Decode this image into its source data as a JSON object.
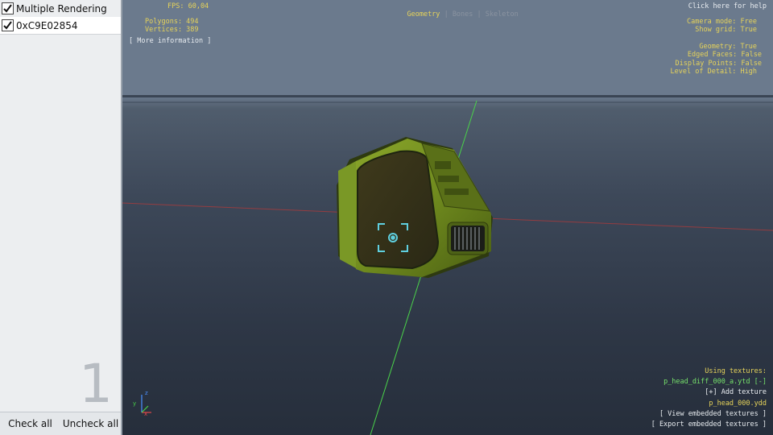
{
  "left_panel": {
    "multiple_rendering_label": "Multiple Rendering",
    "multiple_rendering_checked": true,
    "items": [
      {
        "label": "0xC9E02854",
        "checked": true
      }
    ],
    "item_count": "1",
    "check_all_label": "Check all",
    "uncheck_all_label": "Uncheck all"
  },
  "hud": {
    "fps": "FPS: 60,04",
    "polygons": "Polygons: 494",
    "vertices": "Vertices: 389",
    "more_info": "[ More information ]",
    "tabs": [
      "Geometry",
      "Bones",
      "Skeleton"
    ],
    "tab_sep": "|",
    "help": "Click here for help",
    "camera_mode": "Camera mode: Free",
    "show_grid": "Show grid: True",
    "geometry": "Geometry: True",
    "edged_faces": "Edged Faces: False",
    "display_points": "Display Points: False",
    "level_of_detail": "Level of Detail: High",
    "using_textures": "Using textures:",
    "texture_dict": "p_head_diff_000_a.ytd [-]",
    "add_texture": "[+] Add texture",
    "model_file": "p_head_000.ydd",
    "view_embedded": "[ View embedded textures ]",
    "export_embedded": "[ Export embedded textures ]"
  },
  "colors": {
    "hud_yellow": "#e6d35a",
    "hud_white": "#e8ecf0",
    "hud_green": "#76e06a",
    "model_green": "#6f8a1e"
  },
  "icons": {
    "checkbox": "checkmark-icon",
    "gizmo": "axis-gizmo-icon"
  }
}
